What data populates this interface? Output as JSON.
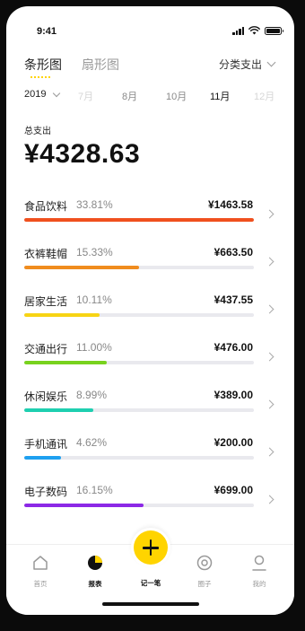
{
  "status_bar": {
    "time": "9:41"
  },
  "view_tabs": [
    {
      "label": "条形图",
      "active": true
    },
    {
      "label": "扇形图",
      "active": false
    }
  ],
  "category_selector": {
    "label": "分类支出"
  },
  "period": {
    "year": "2019",
    "months": [
      {
        "label": "7月",
        "state": "faded"
      },
      {
        "label": "8月",
        "state": "normal"
      },
      {
        "label": "10月",
        "state": "normal"
      },
      {
        "label": "11月",
        "state": "selected"
      },
      {
        "label": "12月",
        "state": "faded"
      }
    ]
  },
  "summary": {
    "label": "总支出",
    "total": "¥4328.63"
  },
  "categories": [
    {
      "name": "食品饮料",
      "percent": "33.81%",
      "amount": "¥1463.58",
      "fill": 1.0,
      "color": "#f0501e"
    },
    {
      "name": "衣裤鞋帽",
      "percent": "15.33%",
      "amount": "¥663.50",
      "fill": 0.5,
      "color": "#f08c1e"
    },
    {
      "name": "居家生活",
      "percent": "10.11%",
      "amount": "¥437.55",
      "fill": 0.33,
      "color": "#f7d414"
    },
    {
      "name": "交通出行",
      "percent": "11.00%",
      "amount": "¥476.00",
      "fill": 0.36,
      "color": "#78d21e"
    },
    {
      "name": "休闲娱乐",
      "percent": "8.99%",
      "amount": "¥389.00",
      "fill": 0.3,
      "color": "#1ecfb0"
    },
    {
      "name": "手机通讯",
      "percent": "4.62%",
      "amount": "¥200.00",
      "fill": 0.16,
      "color": "#1ea0f0"
    },
    {
      "name": "电子数码",
      "percent": "16.15%",
      "amount": "¥699.00",
      "fill": 0.52,
      "color": "#8c28e6"
    }
  ],
  "tab_bar": {
    "home": "首页",
    "report": "报表",
    "add": "记一笔",
    "circle": "圈子",
    "mine": "我的"
  }
}
